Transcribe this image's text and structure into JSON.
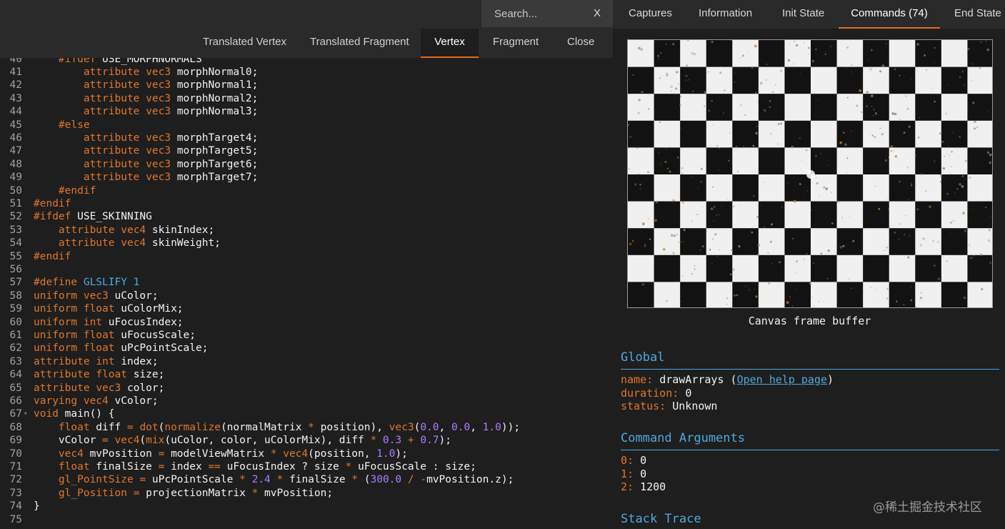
{
  "search": {
    "placeholder": "Search...",
    "clear_label": "X"
  },
  "top_tabs": [
    {
      "label": "Captures",
      "active": false
    },
    {
      "label": "Information",
      "active": false
    },
    {
      "label": "Init State",
      "active": false
    },
    {
      "label": "Commands (74)",
      "active": true
    },
    {
      "label": "End State",
      "active": false
    }
  ],
  "shader_tabs": [
    {
      "label": "Translated Vertex",
      "active": false
    },
    {
      "label": "Translated Fragment",
      "active": false
    },
    {
      "label": "Vertex",
      "active": true
    },
    {
      "label": "Fragment",
      "active": false
    },
    {
      "label": "Close",
      "active": false
    }
  ],
  "code": {
    "first_partial": {
      "n": "40",
      "tokens": [
        [
          "pp",
          "    #ifdef "
        ],
        [
          "id",
          "USE_MORPHNORMALS"
        ]
      ]
    },
    "lines": [
      {
        "n": "41",
        "tokens": [
          [
            "id",
            "        "
          ],
          [
            "kw",
            "attribute"
          ],
          [
            "id",
            " "
          ],
          [
            "ty",
            "vec3"
          ],
          [
            "id",
            " morphNormal0;"
          ]
        ]
      },
      {
        "n": "42",
        "tokens": [
          [
            "id",
            "        "
          ],
          [
            "kw",
            "attribute"
          ],
          [
            "id",
            " "
          ],
          [
            "ty",
            "vec3"
          ],
          [
            "id",
            " morphNormal1;"
          ]
        ]
      },
      {
        "n": "43",
        "tokens": [
          [
            "id",
            "        "
          ],
          [
            "kw",
            "attribute"
          ],
          [
            "id",
            " "
          ],
          [
            "ty",
            "vec3"
          ],
          [
            "id",
            " morphNormal2;"
          ]
        ]
      },
      {
        "n": "44",
        "tokens": [
          [
            "id",
            "        "
          ],
          [
            "kw",
            "attribute"
          ],
          [
            "id",
            " "
          ],
          [
            "ty",
            "vec3"
          ],
          [
            "id",
            " morphNormal3;"
          ]
        ]
      },
      {
        "n": "45",
        "tokens": [
          [
            "id",
            "    "
          ],
          [
            "pp",
            "#else"
          ]
        ]
      },
      {
        "n": "46",
        "tokens": [
          [
            "id",
            "        "
          ],
          [
            "kw",
            "attribute"
          ],
          [
            "id",
            " "
          ],
          [
            "ty",
            "vec3"
          ],
          [
            "id",
            " morphTarget4;"
          ]
        ]
      },
      {
        "n": "47",
        "tokens": [
          [
            "id",
            "        "
          ],
          [
            "kw",
            "attribute"
          ],
          [
            "id",
            " "
          ],
          [
            "ty",
            "vec3"
          ],
          [
            "id",
            " morphTarget5;"
          ]
        ]
      },
      {
        "n": "48",
        "tokens": [
          [
            "id",
            "        "
          ],
          [
            "kw",
            "attribute"
          ],
          [
            "id",
            " "
          ],
          [
            "ty",
            "vec3"
          ],
          [
            "id",
            " morphTarget6;"
          ]
        ]
      },
      {
        "n": "49",
        "tokens": [
          [
            "id",
            "        "
          ],
          [
            "kw",
            "attribute"
          ],
          [
            "id",
            " "
          ],
          [
            "ty",
            "vec3"
          ],
          [
            "id",
            " morphTarget7;"
          ]
        ]
      },
      {
        "n": "50",
        "tokens": [
          [
            "id",
            "    "
          ],
          [
            "pp",
            "#endif"
          ]
        ]
      },
      {
        "n": "51",
        "tokens": [
          [
            "pp",
            "#endif"
          ]
        ]
      },
      {
        "n": "52",
        "tokens": [
          [
            "pp",
            "#ifdef"
          ],
          [
            "id",
            " USE_SKINNING"
          ]
        ]
      },
      {
        "n": "53",
        "tokens": [
          [
            "id",
            "    "
          ],
          [
            "kw",
            "attribute"
          ],
          [
            "id",
            " "
          ],
          [
            "ty",
            "vec4"
          ],
          [
            "id",
            " skinIndex;"
          ]
        ]
      },
      {
        "n": "54",
        "tokens": [
          [
            "id",
            "    "
          ],
          [
            "kw",
            "attribute"
          ],
          [
            "id",
            " "
          ],
          [
            "ty",
            "vec4"
          ],
          [
            "id",
            " skinWeight;"
          ]
        ]
      },
      {
        "n": "55",
        "tokens": [
          [
            "pp",
            "#endif"
          ]
        ]
      },
      {
        "n": "56",
        "tokens": []
      },
      {
        "n": "57",
        "tokens": [
          [
            "pp",
            "#define"
          ],
          [
            "id",
            " "
          ],
          [
            "def",
            "GLSLIFY 1"
          ]
        ]
      },
      {
        "n": "58",
        "tokens": [
          [
            "kw",
            "uniform"
          ],
          [
            "id",
            " "
          ],
          [
            "ty",
            "vec3"
          ],
          [
            "id",
            " uColor;"
          ]
        ]
      },
      {
        "n": "59",
        "tokens": [
          [
            "kw",
            "uniform"
          ],
          [
            "id",
            " "
          ],
          [
            "ty",
            "float"
          ],
          [
            "id",
            " uColorMix;"
          ]
        ]
      },
      {
        "n": "60",
        "tokens": [
          [
            "kw",
            "uniform"
          ],
          [
            "id",
            " "
          ],
          [
            "ty",
            "int"
          ],
          [
            "id",
            " uFocusIndex;"
          ]
        ]
      },
      {
        "n": "61",
        "tokens": [
          [
            "kw",
            "uniform"
          ],
          [
            "id",
            " "
          ],
          [
            "ty",
            "float"
          ],
          [
            "id",
            " uFocusScale;"
          ]
        ]
      },
      {
        "n": "62",
        "tokens": [
          [
            "kw",
            "uniform"
          ],
          [
            "id",
            " "
          ],
          [
            "ty",
            "float"
          ],
          [
            "id",
            " uPcPointScale;"
          ]
        ]
      },
      {
        "n": "63",
        "tokens": [
          [
            "kw",
            "attribute"
          ],
          [
            "id",
            " "
          ],
          [
            "ty",
            "int"
          ],
          [
            "id",
            " index;"
          ]
        ]
      },
      {
        "n": "64",
        "tokens": [
          [
            "kw",
            "attribute"
          ],
          [
            "id",
            " "
          ],
          [
            "ty",
            "float"
          ],
          [
            "id",
            " size;"
          ]
        ]
      },
      {
        "n": "65",
        "tokens": [
          [
            "kw",
            "attribute"
          ],
          [
            "id",
            " "
          ],
          [
            "ty",
            "vec3"
          ],
          [
            "id",
            " color;"
          ]
        ]
      },
      {
        "n": "66",
        "tokens": [
          [
            "kw",
            "varying"
          ],
          [
            "id",
            " "
          ],
          [
            "ty",
            "vec4"
          ],
          [
            "id",
            " vColor;"
          ]
        ]
      },
      {
        "n": "67",
        "fold": true,
        "tokens": [
          [
            "ty",
            "void"
          ],
          [
            "id",
            " main() {"
          ]
        ]
      },
      {
        "n": "68",
        "tokens": [
          [
            "id",
            "    "
          ],
          [
            "ty",
            "float"
          ],
          [
            "id",
            " diff "
          ],
          [
            "op",
            "="
          ],
          [
            "id",
            " "
          ],
          [
            "kw",
            "dot"
          ],
          [
            "id",
            "("
          ],
          [
            "kw",
            "normalize"
          ],
          [
            "id",
            "(normalMatrix "
          ],
          [
            "op",
            "*"
          ],
          [
            "id",
            " position), "
          ],
          [
            "ty",
            "vec3"
          ],
          [
            "id",
            "("
          ],
          [
            "num",
            "0.0"
          ],
          [
            "id",
            ", "
          ],
          [
            "num",
            "0.0"
          ],
          [
            "id",
            ", "
          ],
          [
            "num",
            "1.0"
          ],
          [
            "id",
            "));"
          ]
        ]
      },
      {
        "n": "69",
        "tokens": [
          [
            "id",
            "    vColor "
          ],
          [
            "op",
            "="
          ],
          [
            "id",
            " "
          ],
          [
            "ty",
            "vec4"
          ],
          [
            "id",
            "("
          ],
          [
            "kw",
            "mix"
          ],
          [
            "id",
            "(uColor, color, uColorMix), diff "
          ],
          [
            "op",
            "*"
          ],
          [
            "id",
            " "
          ],
          [
            "num",
            "0.3"
          ],
          [
            "id",
            " "
          ],
          [
            "op",
            "+"
          ],
          [
            "id",
            " "
          ],
          [
            "num",
            "0.7"
          ],
          [
            "id",
            ");"
          ]
        ]
      },
      {
        "n": "70",
        "tokens": [
          [
            "id",
            "    "
          ],
          [
            "ty",
            "vec4"
          ],
          [
            "id",
            " mvPosition "
          ],
          [
            "op",
            "="
          ],
          [
            "id",
            " modelViewMatrix "
          ],
          [
            "op",
            "*"
          ],
          [
            "id",
            " "
          ],
          [
            "ty",
            "vec4"
          ],
          [
            "id",
            "(position, "
          ],
          [
            "num",
            "1.0"
          ],
          [
            "id",
            ");"
          ]
        ]
      },
      {
        "n": "71",
        "tokens": [
          [
            "id",
            "    "
          ],
          [
            "ty",
            "float"
          ],
          [
            "id",
            " finalSize "
          ],
          [
            "op",
            "="
          ],
          [
            "id",
            " index "
          ],
          [
            "op",
            "=="
          ],
          [
            "id",
            " uFocusIndex ? size "
          ],
          [
            "op",
            "*"
          ],
          [
            "id",
            " uFocusScale : size;"
          ]
        ]
      },
      {
        "n": "72",
        "tokens": [
          [
            "id",
            "    "
          ],
          [
            "kw",
            "gl_PointSize"
          ],
          [
            "id",
            " "
          ],
          [
            "op",
            "="
          ],
          [
            "id",
            " uPcPointScale "
          ],
          [
            "op",
            "*"
          ],
          [
            "id",
            " "
          ],
          [
            "num",
            "2.4"
          ],
          [
            "id",
            " "
          ],
          [
            "op",
            "*"
          ],
          [
            "id",
            " finalSize "
          ],
          [
            "op",
            "*"
          ],
          [
            "id",
            " ("
          ],
          [
            "num",
            "300.0"
          ],
          [
            "id",
            " "
          ],
          [
            "op",
            "/"
          ],
          [
            "id",
            " "
          ],
          [
            "op",
            "-"
          ],
          [
            "id",
            "mvPosition.z);"
          ]
        ]
      },
      {
        "n": "73",
        "tokens": [
          [
            "id",
            "    "
          ],
          [
            "kw",
            "gl_Position"
          ],
          [
            "id",
            " "
          ],
          [
            "op",
            "="
          ],
          [
            "id",
            " projectionMatrix "
          ],
          [
            "op",
            "*"
          ],
          [
            "id",
            " mvPosition;"
          ]
        ]
      },
      {
        "n": "74",
        "tokens": [
          [
            "id",
            "}"
          ]
        ]
      },
      {
        "n": "75",
        "tokens": []
      }
    ]
  },
  "canvas": {
    "caption": "Canvas frame buffer",
    "colors": {
      "light": "#f0f0f0",
      "dark": "#121212",
      "spark_orange": "#c77a2a",
      "spark_grey": "#8a8a8a"
    }
  },
  "global": {
    "title": "Global",
    "name_key": "name:",
    "name_value": "drawArrays",
    "help_link": "Open help page",
    "duration_key": "duration:",
    "duration_value": "0",
    "status_key": "status:",
    "status_value": "Unknown"
  },
  "command_arguments": {
    "title": "Command Arguments",
    "items": [
      {
        "key": "0:",
        "value": "0"
      },
      {
        "key": "1:",
        "value": "0"
      },
      {
        "key": "2:",
        "value": "1200"
      }
    ]
  },
  "stack_trace": {
    "title": "Stack Trace"
  },
  "watermark": "@稀土掘金技术社区",
  "colors": {
    "accent": "#e26b1d",
    "link": "#4fa8de",
    "keyword": "#e0762b",
    "number": "#ac7dff"
  }
}
